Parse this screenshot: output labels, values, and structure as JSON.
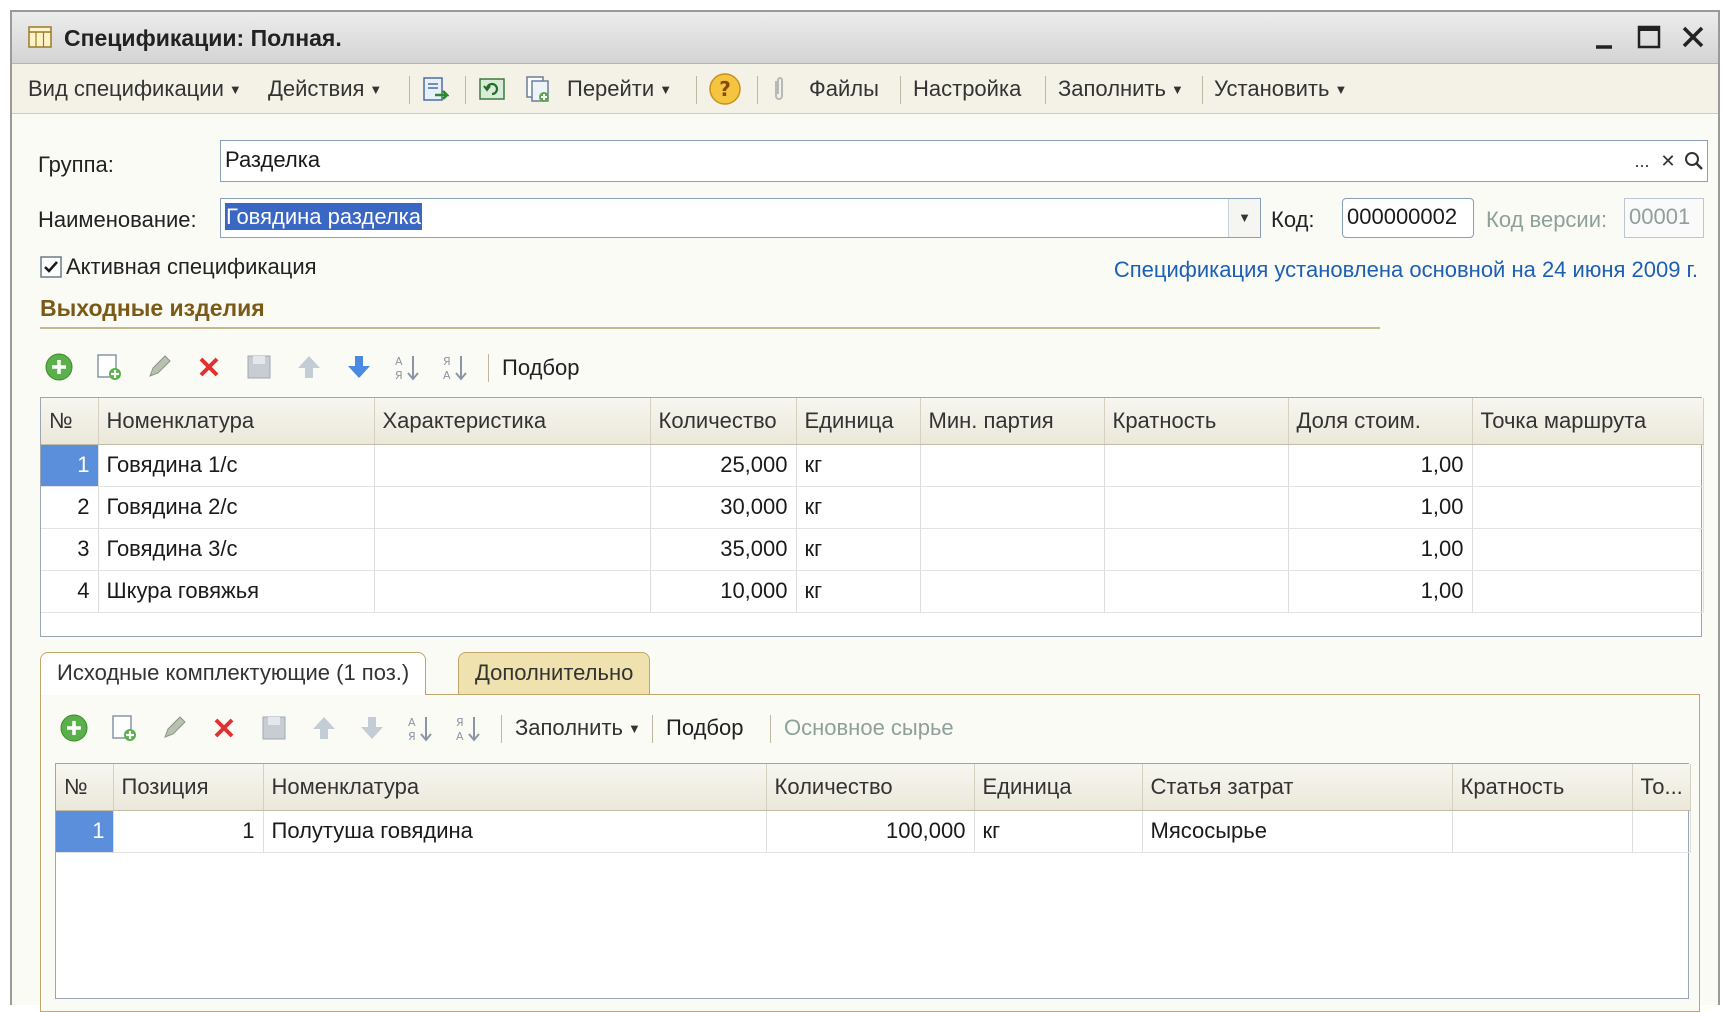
{
  "window": {
    "title": "Спецификации: Полная.",
    "controls": {
      "minimize": "_",
      "maximize": "□",
      "close": "✕"
    }
  },
  "toolbar": {
    "spec_view": "Вид спецификации",
    "actions": "Действия",
    "go_to": "Перейти",
    "help": "?",
    "files": "Файлы",
    "settings": "Настройка",
    "fill": "Заполнить",
    "install": "Установить",
    "dropdown_arrow": "▼"
  },
  "form": {
    "group_label": "Группа:",
    "group_value": "Разделка",
    "name_label": "Наименование:",
    "name_value": "Говядина разделка",
    "code_label": "Код:",
    "code_value": "000000002",
    "version_label": "Код версии:",
    "version_value": "00001",
    "active_checkbox_label": "Активная спецификация",
    "active_checked": true,
    "status_link": "Спецификация установлена основной на 24 июня 2009 г.",
    "field_buttons": {
      "ellipsis": "...",
      "clear": "✕",
      "search": "⌕",
      "dropdown": "▼"
    }
  },
  "output_section": {
    "title": "Выходные изделия",
    "select_button": "Подбор",
    "columns": [
      "№",
      "Номенклатура",
      "Характеристика",
      "Количество",
      "Единица",
      "Мин. партия",
      "Кратность",
      "Доля стоим.",
      "Точка маршрута"
    ],
    "rows": [
      {
        "n": "1",
        "item": "Говядина 1/с",
        "char": "",
        "qty": "25,000",
        "unit": "кг",
        "min": "",
        "mult": "",
        "share": "1,00",
        "route": ""
      },
      {
        "n": "2",
        "item": "Говядина 2/с",
        "char": "",
        "qty": "30,000",
        "unit": "кг",
        "min": "",
        "mult": "",
        "share": "1,00",
        "route": ""
      },
      {
        "n": "3",
        "item": "Говядина 3/с",
        "char": "",
        "qty": "35,000",
        "unit": "кг",
        "min": "",
        "mult": "",
        "share": "1,00",
        "route": ""
      },
      {
        "n": "4",
        "item": "Шкура говяжья",
        "char": "",
        "qty": "10,000",
        "unit": "кг",
        "min": "",
        "mult": "",
        "share": "1,00",
        "route": ""
      }
    ]
  },
  "tabs": {
    "components": "Исходные комплектующие (1 поз.)",
    "additional": "Дополнительно"
  },
  "components_section": {
    "fill_button": "Заполнить",
    "select_button": "Подбор",
    "main_material": "Основное сырье",
    "columns": [
      "№",
      "Позиция",
      "Номенклатура",
      "Количество",
      "Единица",
      "Статья затрат",
      "Кратность",
      "То..."
    ],
    "rows": [
      {
        "n": "1",
        "pos": "1",
        "item": "Полутуша говядина",
        "qty": "100,000",
        "unit": "кг",
        "cost": "Мясосырье",
        "mult": "",
        "to": ""
      }
    ]
  },
  "colors": {
    "accent_blue": "#3a66c4",
    "section_title": "#7a5a17",
    "link": "#1d5fb4",
    "tab_inactive": "#f0e2ae"
  }
}
